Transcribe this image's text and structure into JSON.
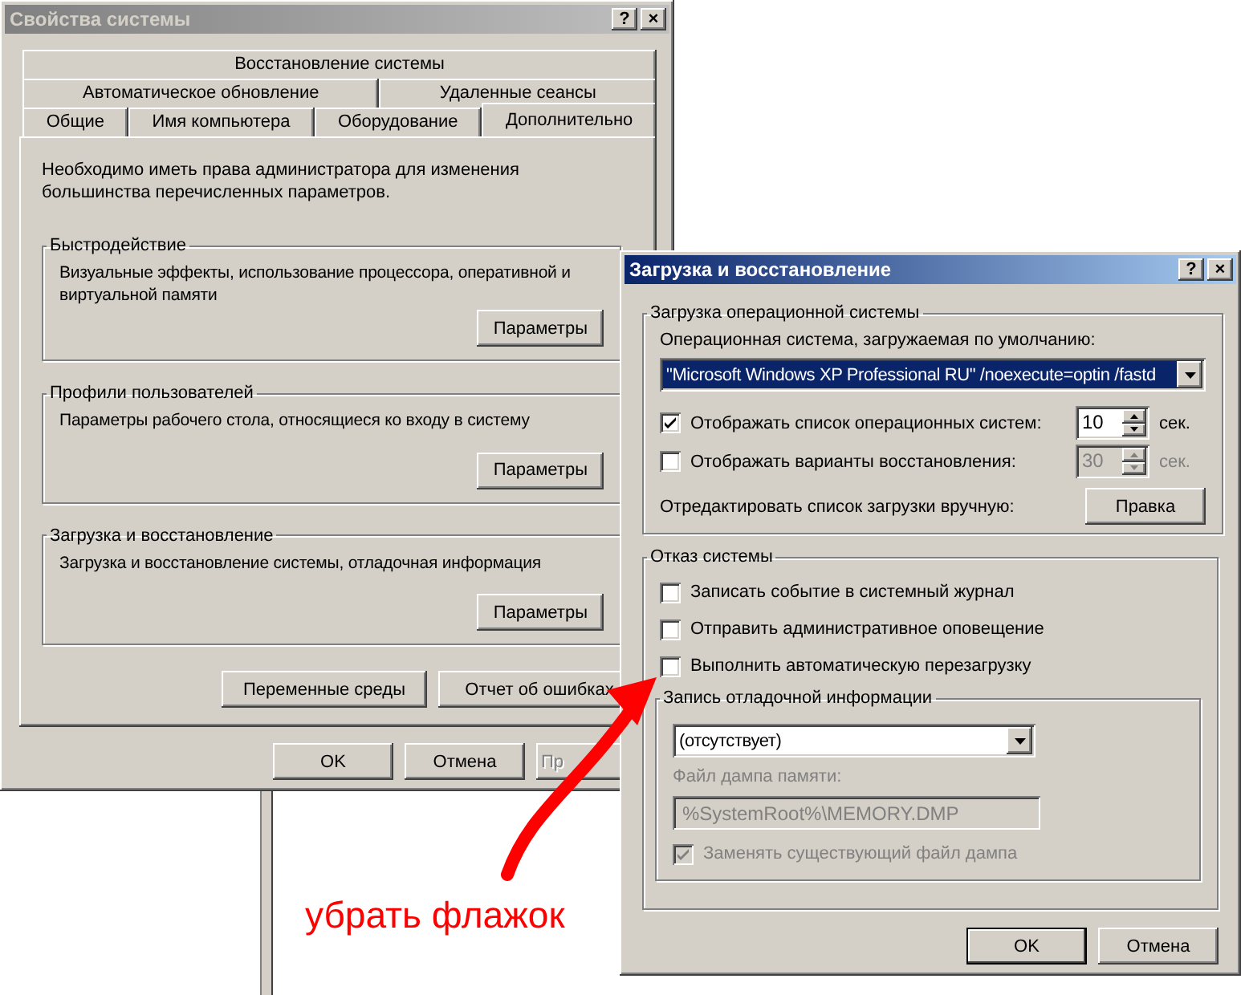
{
  "main_window": {
    "title": "Свойства системы",
    "active": false,
    "title_buttons": [
      "?",
      "×"
    ],
    "tab_rows": [
      [
        {
          "label": "Восстановление системы",
          "selected": false
        }
      ],
      [
        {
          "label": "Автоматическое обновление",
          "selected": false
        },
        {
          "label": "Удаленные сеансы",
          "selected": false
        }
      ],
      [
        {
          "label": "Общие",
          "selected": false
        },
        {
          "label": "Имя компьютера",
          "selected": false
        },
        {
          "label": "Оборудование",
          "selected": false
        },
        {
          "label": "Дополнительно",
          "selected": true
        }
      ]
    ],
    "notice": "Необходимо иметь права администратора для изменения большинства перечисленных параметров.",
    "groups": [
      {
        "title": "Быстродействие",
        "description": "Визуальные эффекты, использование процессора, оперативной и виртуальной памяти",
        "button": "Параметры"
      },
      {
        "title": "Профили пользователей",
        "description": "Параметры рабочего стола, относящиеся ко входу в систему",
        "button": "Параметры"
      },
      {
        "title": "Загрузка и восстановление",
        "description": "Загрузка и восстановление системы, отладочная информация",
        "button": "Параметры"
      }
    ],
    "extra_buttons": [
      "Переменные среды",
      "Отчет об ошибках"
    ],
    "buttons": [
      {
        "label": "OK",
        "disabled": false
      },
      {
        "label": "Отмена",
        "disabled": false
      },
      {
        "label": "Пр",
        "disabled": true
      }
    ]
  },
  "dialog": {
    "title": "Загрузка и восстановление",
    "active": true,
    "title_buttons": [
      "?",
      "×"
    ],
    "startup": {
      "title": "Загрузка операционной системы",
      "default_os_label": "Операционная система, загружаемая по умолчанию:",
      "default_os": "\"Microsoft Windows XP Professional RU\" /noexecute=optin /fastd",
      "options": [
        {
          "label": "Отображать список операционных систем:",
          "checked": true,
          "value": "10",
          "unit": "сек.",
          "disabled": false
        },
        {
          "label": "Отображать варианты восстановления:",
          "checked": false,
          "value": "30",
          "unit": "сек.",
          "disabled": true
        }
      ],
      "edit_label": "Отредактировать список загрузки вручную:",
      "edit_button": "Правка"
    },
    "failure": {
      "title": "Отказ системы",
      "options": [
        {
          "label": "Записать событие в системный журнал",
          "checked": false
        },
        {
          "label": "Отправить административное оповещение",
          "checked": false
        },
        {
          "label": "Выполнить автоматическую перезагрузку",
          "checked": false
        }
      ],
      "debug": {
        "title": "Запись отладочной информации",
        "type": "(отсутствует)",
        "file_label": "Файл дампа памяти:",
        "file": "%SystemRoot%\\MEMORY.DMP",
        "disabled": true,
        "overwrite": {
          "label": "Заменять существующий файл дампа",
          "checked": true
        }
      }
    },
    "buttons": [
      "OK",
      "Отмена"
    ]
  },
  "annotation": {
    "text": "убрать флажок"
  }
}
